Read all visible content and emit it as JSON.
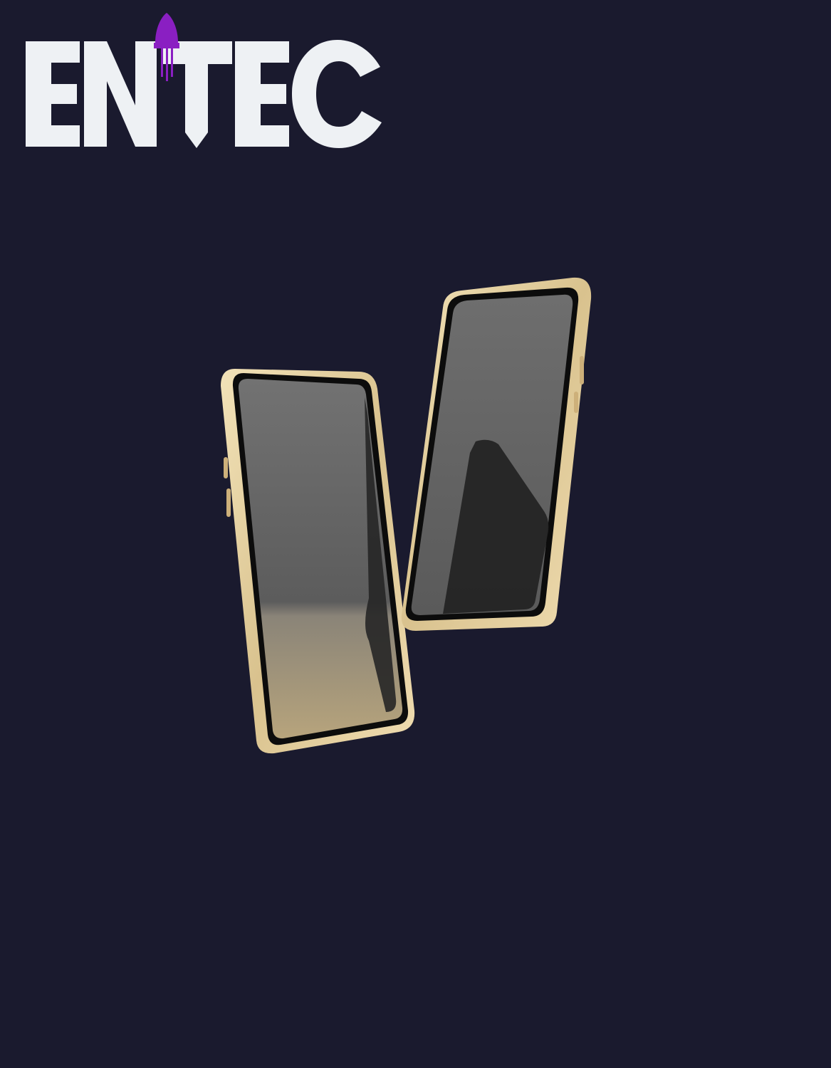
{
  "brand": {
    "logo_text": "ENTEC",
    "text_color": "#eef1f4",
    "accent_color": "#8a1fc2"
  },
  "background_color": "#1a1a2e",
  "hero": {
    "subject": "two-gold-smartphones-icon",
    "frame_color": "#e6d3a6",
    "screen_color": "#5f5f5f"
  }
}
